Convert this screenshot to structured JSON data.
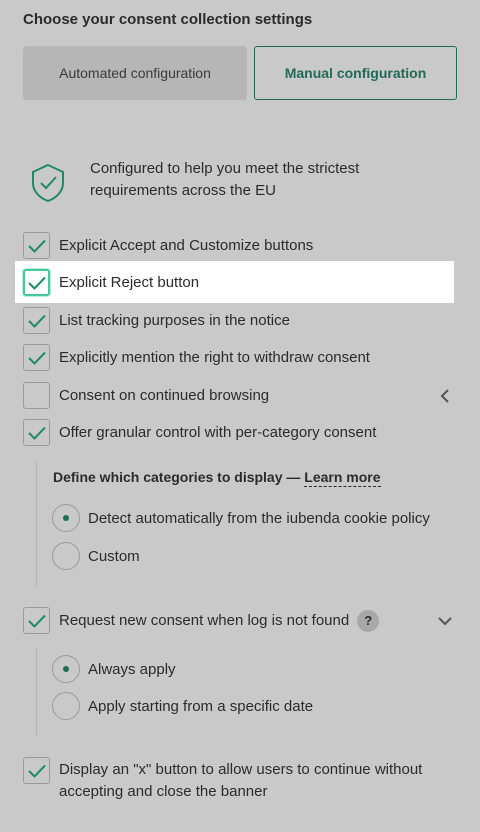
{
  "heading": "Choose your consent collection settings",
  "modes": {
    "automated": "Automated configuration",
    "manual": "Manual configuration"
  },
  "intro": "Configured to help you meet the strictest requirements across the EU",
  "options": [
    {
      "label": "Explicit Accept and Customize buttons",
      "checked": true
    },
    {
      "label": "Explicit Reject button",
      "checked": true
    },
    {
      "label": "List tracking purposes in the notice",
      "checked": true
    },
    {
      "label": "Explicitly mention the right to withdraw consent",
      "checked": true
    },
    {
      "label": "Consent on continued browsing",
      "checked": false
    },
    {
      "label": "Offer granular control with per-category consent",
      "checked": true
    },
    {
      "label": "Request new consent when log is not found",
      "checked": true
    },
    {
      "label": "Display an \"x\" button to allow users to continue without accepting and close the banner",
      "checked": true
    }
  ],
  "categories": {
    "heading": "Define which categories to display —",
    "link": "Learn more",
    "radios": [
      {
        "label": "Detect automatically from the iubenda cookie policy",
        "selected": true
      },
      {
        "label": "Custom",
        "selected": false
      }
    ]
  },
  "log": {
    "help": "?",
    "radios": [
      {
        "label": "Always apply",
        "selected": true
      },
      {
        "label": "Apply starting from a specific date",
        "selected": false
      }
    ]
  },
  "colors": {
    "accent": "#1f6b54",
    "check": "#1f8a66",
    "focus": "#48c79a",
    "background": "#c9c9c9"
  }
}
